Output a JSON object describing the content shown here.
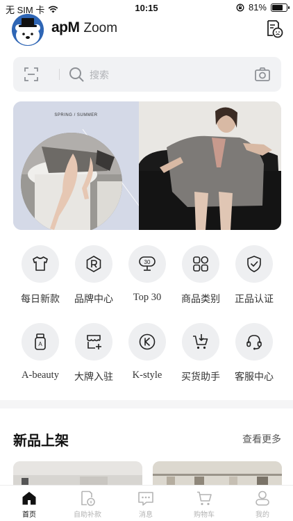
{
  "status_bar": {
    "carrier": "无 SIM 卡",
    "time": "10:15",
    "battery_percent": "81%",
    "battery_level": 0.81
  },
  "header": {
    "brand_mark": "apM",
    "brand_name": "Zoom"
  },
  "search": {
    "placeholder": "搜索"
  },
  "banner": {
    "tag": "SPRING / SUMMER"
  },
  "grid": [
    {
      "label": "每日新款",
      "icon": "tshirt-icon"
    },
    {
      "label": "品牌中心",
      "icon": "brand-r-icon"
    },
    {
      "label": "Top 30",
      "icon": "top30-trophy-icon"
    },
    {
      "label": "商品类别",
      "icon": "category-icon"
    },
    {
      "label": "正品认证",
      "icon": "shield-check-icon"
    },
    {
      "label": "A-beauty",
      "icon": "cosmetic-bottle-icon"
    },
    {
      "label": "大牌入驻",
      "icon": "store-add-icon"
    },
    {
      "label": "K-style",
      "icon": "k-style-icon"
    },
    {
      "label": "买货助手",
      "icon": "cart-download-icon"
    },
    {
      "label": "客服中心",
      "icon": "headset-icon"
    }
  ],
  "section": {
    "title": "新品上架",
    "more": "查看更多"
  },
  "tabs": [
    {
      "label": "首页",
      "icon": "home-icon",
      "active": true
    },
    {
      "label": "自助补款",
      "icon": "payment-icon",
      "active": false
    },
    {
      "label": "消息",
      "icon": "message-icon",
      "active": false
    },
    {
      "label": "购物车",
      "icon": "cart-icon",
      "active": false
    },
    {
      "label": "我的",
      "icon": "profile-icon",
      "active": false
    }
  ],
  "colors": {
    "avatar_bg": "#2f66b5",
    "search_bg": "#f1f2f4",
    "grid_circle_bg": "#eeeff1",
    "tab_active": "#111111",
    "tab_inactive": "#b4b4b4"
  }
}
